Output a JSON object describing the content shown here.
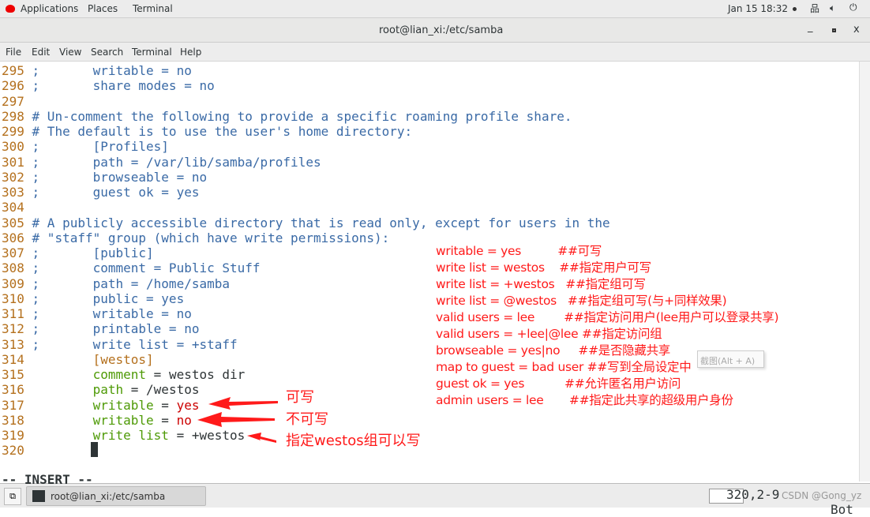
{
  "topbar": {
    "applications": "Applications",
    "places": "Places",
    "terminal": "Terminal",
    "clock": "Jan 15 18:32"
  },
  "window": {
    "title": "root@lian_xi:/etc/samba"
  },
  "menu": [
    "File",
    "Edit",
    "View",
    "Search",
    "Terminal",
    "Help"
  ],
  "lines": [
    {
      "n": "295",
      "s": [
        [
          "cm",
          " ;       writable = no"
        ]
      ]
    },
    {
      "n": "296",
      "s": [
        [
          "cm",
          " ;       share modes = no"
        ]
      ]
    },
    {
      "n": "297",
      "s": []
    },
    {
      "n": "298",
      "s": [
        [
          "cm",
          " # Un-comment the following to provide a specific roaming profile share."
        ]
      ]
    },
    {
      "n": "299",
      "s": [
        [
          "cm",
          " # The default is to use the user's home directory:"
        ]
      ]
    },
    {
      "n": "300",
      "s": [
        [
          "cm",
          " ;       [Profiles]"
        ]
      ]
    },
    {
      "n": "301",
      "s": [
        [
          "cm",
          " ;       path = /var/lib/samba/profiles"
        ]
      ]
    },
    {
      "n": "302",
      "s": [
        [
          "cm",
          " ;       browseable = no"
        ]
      ]
    },
    {
      "n": "303",
      "s": [
        [
          "cm",
          " ;       guest ok = yes"
        ]
      ]
    },
    {
      "n": "304",
      "s": []
    },
    {
      "n": "305",
      "s": [
        [
          "cm",
          " # A publicly accessible directory that is read only, except for users in the"
        ]
      ]
    },
    {
      "n": "306",
      "s": [
        [
          "cm",
          " # \"staff\" group (which have write permissions):"
        ]
      ]
    },
    {
      "n": "307",
      "s": [
        [
          "cm",
          " ;       [public]"
        ]
      ]
    },
    {
      "n": "308",
      "s": [
        [
          "cm",
          " ;       comment = Public Stuff"
        ]
      ]
    },
    {
      "n": "309",
      "s": [
        [
          "cm",
          " ;       path = /home/samba"
        ]
      ]
    },
    {
      "n": "310",
      "s": [
        [
          "cm",
          " ;       public = yes"
        ]
      ]
    },
    {
      "n": "311",
      "s": [
        [
          "cm",
          " ;       writable = no"
        ]
      ]
    },
    {
      "n": "312",
      "s": [
        [
          "cm",
          " ;       printable = no"
        ]
      ]
    },
    {
      "n": "313",
      "s": [
        [
          "cm",
          " ;       write list = +staff"
        ]
      ]
    },
    {
      "n": "314",
      "s": [
        [
          "tx",
          "         "
        ],
        [
          "br",
          "[westos]"
        ]
      ]
    },
    {
      "n": "315",
      "s": [
        [
          "tx",
          "         "
        ],
        [
          "kw",
          "comment"
        ],
        [
          "tx",
          " = westos dir"
        ]
      ]
    },
    {
      "n": "316",
      "s": [
        [
          "tx",
          "         "
        ],
        [
          "kw",
          "path"
        ],
        [
          "tx",
          " = /westos"
        ]
      ]
    },
    {
      "n": "317",
      "s": [
        [
          "tx",
          "         "
        ],
        [
          "kw",
          "writable"
        ],
        [
          "tx",
          " = "
        ],
        [
          "rd",
          "yes"
        ]
      ]
    },
    {
      "n": "318",
      "s": [
        [
          "tx",
          "         "
        ],
        [
          "kw",
          "writable"
        ],
        [
          "tx",
          " = "
        ],
        [
          "rd",
          "no"
        ]
      ]
    },
    {
      "n": "319",
      "s": [
        [
          "tx",
          "         "
        ],
        [
          "kw",
          "write list"
        ],
        [
          "tx",
          " = +westos"
        ]
      ]
    },
    {
      "n": "320",
      "s": []
    }
  ],
  "status": {
    "mode": "-- INSERT --",
    "position": "320,2-9",
    "scroll": "Bot"
  },
  "notes": [
    "writable = yes          ##可写",
    "write list = westos    ##指定用户可写",
    "write list = +westos   ##指定组可写",
    "write list = @westos   ##指定组可写(与+同样效果)",
    "valid users = lee        ##指定访问用户(lee用户可以登录共享)",
    "valid users = +lee|@lee ##指定访问组",
    "browseable = yes|no     ##是否隐藏共享",
    "map to guest = bad user ##写到全局设定中",
    "guest ok = yes           ##允许匿名用户访问",
    "admin users = lee       ##指定此共享的超级用户身份"
  ],
  "arrow_labels": [
    "可写",
    "不可写",
    "指定westos组可以写"
  ],
  "tooltip": "截图(Alt + A)",
  "taskbar": {
    "window": "root@lian_xi:/etc/samba",
    "watermark": "CSDN @Gong_yz"
  },
  "colors": {
    "annotation": "#ff1a1a",
    "comment": "#3a6aa6",
    "line_number": "#b4701d",
    "keyword": "#4e9a06"
  }
}
